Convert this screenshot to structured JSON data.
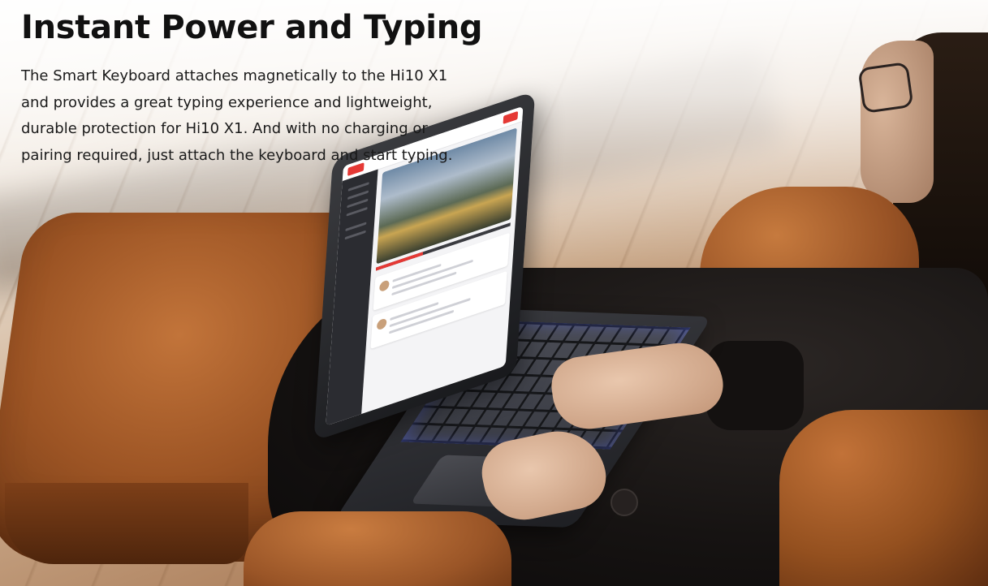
{
  "banner": {
    "headline": "Instant Power and Typing",
    "description": "The Smart Keyboard attaches magnetically to the Hi10 X1 and provides a great typing experience and lightweight, durable protection for Hi10 X1. And with no charging or pairing required, just attach the keyboard and start typing."
  },
  "colors": {
    "headline_text": "#111111",
    "body_text": "#1a1a1a",
    "leather": "#9c5424",
    "app_accent": "#e53935"
  }
}
